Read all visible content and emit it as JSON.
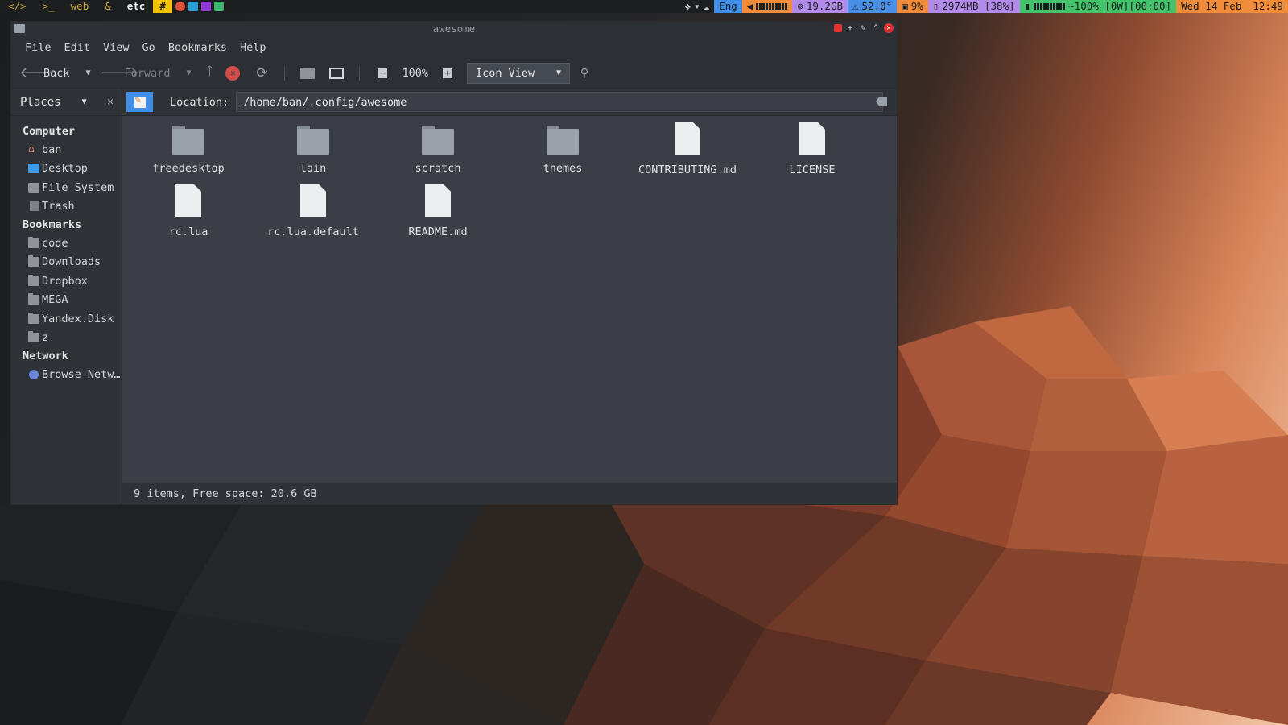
{
  "topbar": {
    "tags": [
      "</>",
      ">_",
      "web",
      "&",
      "etc",
      "#"
    ],
    "keyboard_layout": "Eng",
    "disk": "19.2GB",
    "temperature": "52.0°",
    "cpu": "9%",
    "memory": "2974MB [38%]",
    "battery": "~100% [0W][00:00]",
    "date": "Wed 14 Feb",
    "time": "12:49",
    "volume_level": 1.0
  },
  "window": {
    "title": "awesome"
  },
  "menubar": [
    "File",
    "Edit",
    "View",
    "Go",
    "Bookmarks",
    "Help"
  ],
  "toolbar": {
    "back": "Back",
    "forward": "Forward",
    "zoom": "100%",
    "view_mode": "Icon View"
  },
  "sidebar": {
    "header": "Places",
    "sections": [
      {
        "title": "Computer",
        "items": [
          {
            "label": "ban",
            "icon": "home-icon"
          },
          {
            "label": "Desktop",
            "icon": "desktop-icon"
          },
          {
            "label": "File System",
            "icon": "drive-icon"
          },
          {
            "label": "Trash",
            "icon": "trash-icon"
          }
        ]
      },
      {
        "title": "Bookmarks",
        "items": [
          {
            "label": "code",
            "icon": "folder-icon"
          },
          {
            "label": "Downloads",
            "icon": "folder-icon"
          },
          {
            "label": "Dropbox",
            "icon": "folder-icon"
          },
          {
            "label": "MEGA",
            "icon": "folder-icon"
          },
          {
            "label": "Yandex.Disk",
            "icon": "folder-icon"
          },
          {
            "label": "z",
            "icon": "folder-icon"
          }
        ]
      },
      {
        "title": "Network",
        "items": [
          {
            "label": "Browse Netw…",
            "icon": "network-icon"
          }
        ]
      }
    ]
  },
  "location": {
    "label": "Location:",
    "path": "/home/ban/.config/awesome"
  },
  "files": [
    {
      "name": "freedesktop",
      "type": "folder"
    },
    {
      "name": "lain",
      "type": "folder"
    },
    {
      "name": "scratch",
      "type": "folder"
    },
    {
      "name": "themes",
      "type": "folder"
    },
    {
      "name": "CONTRIBUTING.md",
      "type": "file"
    },
    {
      "name": "LICENSE",
      "type": "file"
    },
    {
      "name": "rc.lua",
      "type": "file"
    },
    {
      "name": "rc.lua.default",
      "type": "file"
    },
    {
      "name": "README.md",
      "type": "file"
    }
  ],
  "status": "9 items, Free space: 20.6 GB",
  "colors": {
    "accent": "#3f8fe8",
    "urgent_tag": "#f2c200",
    "close": "#e23434"
  }
}
